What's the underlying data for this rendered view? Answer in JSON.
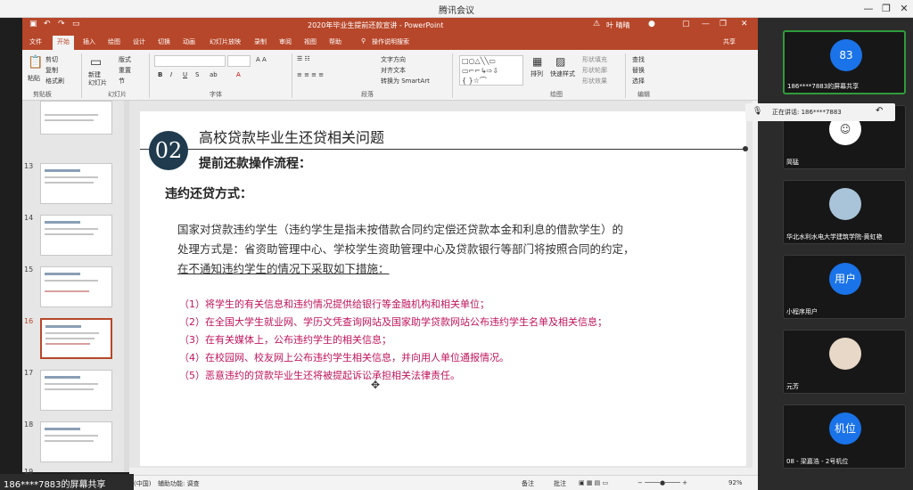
{
  "outer": {
    "title": "腾讯会议",
    "minimize": "—",
    "restore": "❐",
    "close": "✕"
  },
  "ppt": {
    "doc_title": "2020年毕业生提前还款宣讲 - PowerPoint",
    "user_name": "叶 晴晴",
    "tabs": [
      "文件",
      "开始",
      "插入",
      "绘图",
      "设计",
      "切换",
      "动画",
      "幻灯片放映",
      "录制",
      "审阅",
      "视图",
      "帮助",
      "操作说明搜索"
    ],
    "active_tab": "开始",
    "share_label": "共享",
    "ribbon": {
      "clipboard": {
        "paste": "粘贴",
        "cut": "剪切",
        "copy": "复制",
        "format_painter": "格式刷",
        "label": "剪贴板"
      },
      "slides": {
        "new_slide": "新建\n幻灯片",
        "layout": "版式",
        "reset": "重置",
        "section": "节",
        "label": "幻灯片"
      },
      "font": {
        "label": "字体"
      },
      "paragraph": {
        "text_dir": "文字方向",
        "align_text": "对齐文本",
        "smartart": "转换为 SmartArt",
        "label": "段落"
      },
      "drawing": {
        "arrange": "排列",
        "quick_styles": "快速样式",
        "fill": "形状填充",
        "outline": "形状轮廓",
        "effects": "形状效果",
        "label": "绘图"
      },
      "editing": {
        "find": "查找",
        "replace": "替换",
        "select": "选择",
        "label": "编辑"
      }
    },
    "thumbnails": [
      {
        "num": "13"
      },
      {
        "num": "14"
      },
      {
        "num": "15"
      },
      {
        "num": "16",
        "selected": true
      },
      {
        "num": "17"
      },
      {
        "num": "18"
      },
      {
        "num": "19"
      }
    ],
    "slide": {
      "number_badge": "02",
      "title": "高校贷款毕业生还贷相关问题",
      "subtitle": "提前还款操作流程：",
      "section": "违约还贷方式：",
      "body_line1": "国家对贷款违约学生（违约学生是指未按借款合同约定偿还贷款本金和利息的借款学生）的",
      "body_line2": "处理方式是：省资助管理中心、学校学生资助管理中心及贷款银行等部门将按照合同的约定，",
      "body_line3": "在不通知违约学生的情况下采取如下措施：",
      "measures": [
        "（1）将学生的有关信息和违约情况提供给银行等金融机构和相关单位；",
        "（2）在全国大学生就业网、学历文凭查询网站及国家助学贷款网站公布违约学生名单及相关信息；",
        "（3）在有关媒体上，公布违约学生的相关信息；",
        "（4）在校园网、校友网上公布违约学生相关信息，并向用人单位通报情况。",
        "（5）恶意违约的贷款毕业生还将被提起诉讼承担相关法律责任。"
      ]
    },
    "status": {
      "lang": "文(中国)",
      "accessibility": "辅助功能: 调查",
      "notes": "备注",
      "comments": "批注",
      "zoom": "92%"
    }
  },
  "meeting": {
    "speaking_label": "正在讲话: 186****7883",
    "participants": [
      {
        "name": "186****7883的屏幕共享",
        "avatar_text": "83",
        "avatar_color": "#1a73e8"
      },
      {
        "name": "简猛",
        "avatar_text": "",
        "avatar_color": "#ffffff"
      },
      {
        "name": "华北水利水电大学建筑学院-黄虹艳",
        "avatar_text": "",
        "avatar_color": "#a9c4d8"
      },
      {
        "name": "小程序用户",
        "avatar_text": "用户",
        "avatar_color": "#1a73e8"
      },
      {
        "name": "元芳",
        "avatar_text": "",
        "avatar_color": "#e8d8c8"
      },
      {
        "name": "08 - 梁嘉浩 - 2号机位",
        "avatar_text": "机位",
        "avatar_color": "#1a73e8"
      }
    ],
    "share_banner": "186****7883的屏幕共享"
  }
}
